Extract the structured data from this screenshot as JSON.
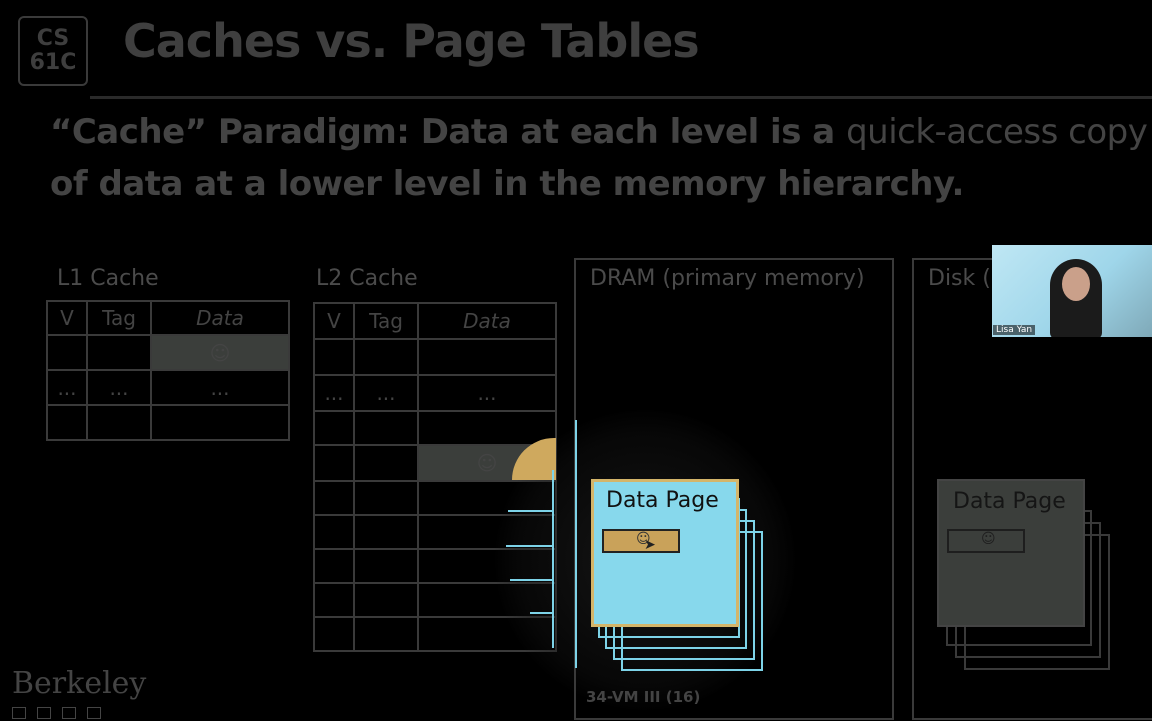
{
  "slide": {
    "logo_line1": "CS",
    "logo_line2": "61C",
    "title": "Caches vs. Page Tables",
    "paragraph": {
      "bold_part1": "“Cache” Paradigm: Data at each level is a ",
      "light_part": "quick-access copy",
      "bold_part2": "of data at a lower level in the memory hierarchy."
    }
  },
  "l1_cache": {
    "label": "L1 Cache",
    "headers": [
      "V",
      "Tag",
      "Data"
    ],
    "rows": [
      [
        "",
        "",
        "☺"
      ],
      [
        "...",
        "...",
        "..."
      ],
      [
        "",
        "",
        ""
      ]
    ]
  },
  "l2_cache": {
    "label": "L2 Cache",
    "headers": [
      "V",
      "Tag",
      "Data"
    ],
    "rows": [
      [
        "",
        "",
        ""
      ],
      [
        "...",
        "...",
        "..."
      ],
      [
        "",
        "",
        ""
      ],
      [
        "",
        "",
        "☺"
      ],
      [
        "",
        "",
        ""
      ],
      [
        "",
        "",
        ""
      ],
      [
        "",
        "",
        ""
      ],
      [
        "",
        "",
        ""
      ],
      [
        "",
        "",
        ""
      ]
    ]
  },
  "dram": {
    "label": "DRAM (primary memory)",
    "page_title": "Data Page",
    "block_glyph": "☺"
  },
  "disk": {
    "label": "Disk (s",
    "page_title": "Data Page",
    "block_glyph": "☺"
  },
  "video": {
    "name": "Lisa Yan"
  },
  "footer": {
    "slide_number": "34-VM III (16)",
    "brand": "Berkeley"
  }
}
